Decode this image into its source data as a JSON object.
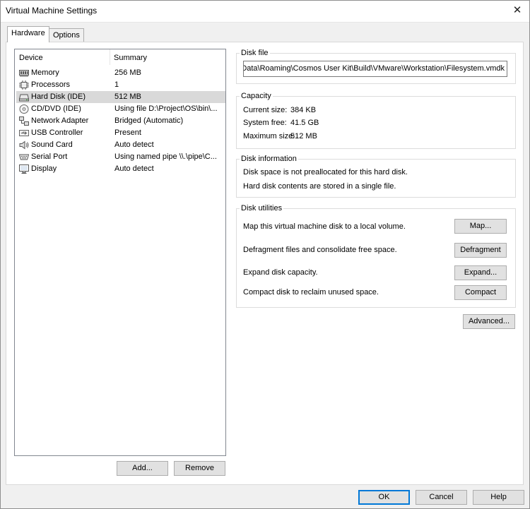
{
  "window": {
    "title": "Virtual Machine Settings"
  },
  "tabs": [
    {
      "label": "Hardware",
      "active": true
    },
    {
      "label": "Options",
      "active": false
    }
  ],
  "device_list": {
    "columns": [
      "Device",
      "Summary"
    ],
    "rows": [
      {
        "icon": "memory-icon",
        "device": "Memory",
        "summary": "256 MB"
      },
      {
        "icon": "processor-icon",
        "device": "Processors",
        "summary": "1"
      },
      {
        "icon": "hard-disk-icon",
        "device": "Hard Disk (IDE)",
        "summary": "512 MB",
        "selected": true
      },
      {
        "icon": "cd-dvd-icon",
        "device": "CD/DVD (IDE)",
        "summary": "Using file D:\\Project\\OS\\bin\\..."
      },
      {
        "icon": "network-adapter-icon",
        "device": "Network Adapter",
        "summary": "Bridged (Automatic)"
      },
      {
        "icon": "usb-icon",
        "device": "USB Controller",
        "summary": "Present"
      },
      {
        "icon": "speaker-icon",
        "device": "Sound Card",
        "summary": "Auto detect"
      },
      {
        "icon": "serial-port-icon",
        "device": "Serial Port",
        "summary": "Using named pipe \\\\.\\pipe\\C..."
      },
      {
        "icon": "display-icon",
        "device": "Display",
        "summary": "Auto detect"
      }
    ],
    "add_label": "Add...",
    "remove_label": "Remove"
  },
  "disk_file": {
    "label": "Disk file",
    "value": "Data\\Roaming\\Cosmos User Kit\\Build\\VMware\\Workstation\\Filesystem.vmdk"
  },
  "capacity": {
    "label": "Capacity",
    "current_label": "Current size:",
    "current_value": "384 KB",
    "free_label": "System free:",
    "free_value": "41.5 GB",
    "max_label": "Maximum size:",
    "max_value": "512 MB"
  },
  "disk_info": {
    "label": "Disk information",
    "line1": "Disk space is not preallocated for this hard disk.",
    "line2": "Hard disk contents are stored in a single file."
  },
  "disk_utilities": {
    "label": "Disk utilities",
    "map_text": "Map this virtual machine disk to a local volume.",
    "map_button": "Map...",
    "defrag_text": "Defragment files and consolidate free space.",
    "defrag_button": "Defragment",
    "expand_text": "Expand disk capacity.",
    "expand_button": "Expand...",
    "compact_text": "Compact disk to reclaim unused space.",
    "compact_button": "Compact"
  },
  "advanced_button": "Advanced...",
  "footer": {
    "ok": "OK",
    "cancel": "Cancel",
    "help": "Help"
  }
}
